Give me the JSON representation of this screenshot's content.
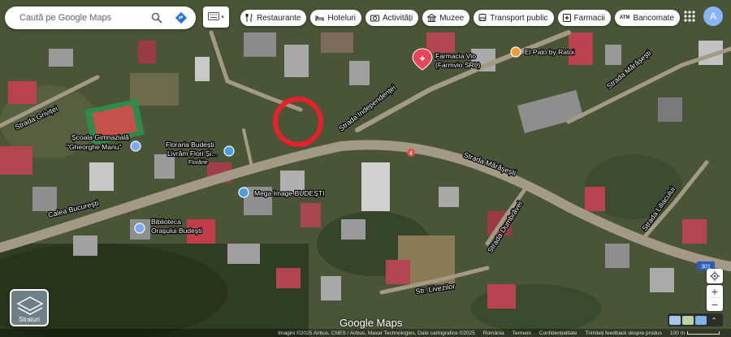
{
  "search": {
    "placeholder": "Caută pe Google Maps"
  },
  "chips": [
    {
      "label": "Restaurante",
      "icon": "fork-knife-icon"
    },
    {
      "label": "Hoteluri",
      "icon": "bed-icon"
    },
    {
      "label": "Activități",
      "icon": "camera-icon"
    },
    {
      "label": "Muzee",
      "icon": "museum-icon"
    },
    {
      "label": "Transport public",
      "icon": "bus-icon"
    },
    {
      "label": "Farmacii",
      "icon": "pharmacy-icon"
    },
    {
      "label": "Bancomate",
      "icon": "atm-icon"
    }
  ],
  "account": {
    "initial": "A"
  },
  "layers": {
    "label": "Straturi"
  },
  "map": {
    "streets": {
      "calea": "Calea Bucureşti",
      "independentei": "Strada Independenței",
      "marasesti_right": "Strada Mărășești",
      "marasesti_top": "Strada Mărășești",
      "grivitei": "Strada Griviței",
      "dumbravei": "Strada Dumbrăvei",
      "livezilor": "Str. Livezilor",
      "liliacului": "Strada Liliacului"
    },
    "pois": {
      "school": [
        "Școala Gimnazială",
        "\"Gheorghe Manu\""
      ],
      "florarie": [
        "Floraria Budești",
        "Livrăm Flori Și..."
      ],
      "florarie_sub": "Florărie",
      "farmacia": [
        "Farmacia Vio",
        "(Farmvio SRL)"
      ],
      "pato": "El Pato by Ratoi",
      "mega": "Mega Image BUDEȘTI",
      "biblioteca": [
        "Biblioteca",
        "Orașului Budești"
      ]
    },
    "route_shields": {
      "main": "4",
      "right": "301"
    },
    "marker_color": "#e8202a"
  },
  "brand": "Google Maps",
  "footer": {
    "attribution": "Imagini ©2025 Airbus, CNES / Airbus, Maxar Technologies, Date cartografice ©2025",
    "country": "România",
    "terms": "Termeni",
    "privacy": "Confidențialitate",
    "feedback": "Trimiteți feedback despre produs",
    "scale": "100 m"
  }
}
